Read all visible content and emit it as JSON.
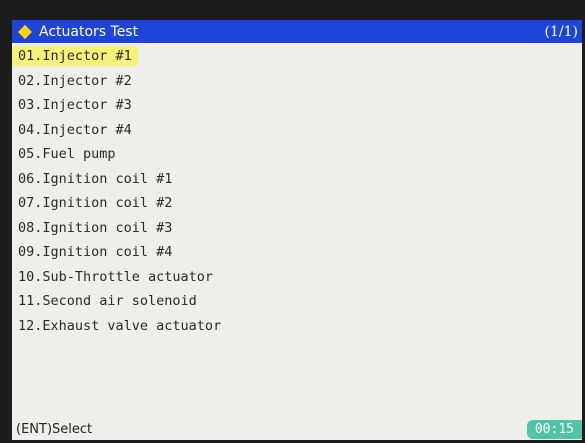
{
  "header": {
    "title": "Actuators Test",
    "page_indicator": "(1/1)",
    "icon": "diamond-icon",
    "accent_color": "#1f44d8"
  },
  "list": {
    "selected_index": 0,
    "items": [
      {
        "label": "01.Injector #1"
      },
      {
        "label": "02.Injector #2"
      },
      {
        "label": "03.Injector #3"
      },
      {
        "label": "04.Injector #4"
      },
      {
        "label": "05.Fuel pump"
      },
      {
        "label": "06.Ignition coil #1"
      },
      {
        "label": "07.Ignition coil #2"
      },
      {
        "label": "08.Ignition coil #3"
      },
      {
        "label": "09.Ignition coil #4"
      },
      {
        "label": "10.Sub-Throttle actuator"
      },
      {
        "label": "11.Second air solenoid"
      },
      {
        "label": "12.Exhaust valve actuator"
      }
    ]
  },
  "footer": {
    "hint": "(ENT)Select",
    "timer": "00:15"
  }
}
